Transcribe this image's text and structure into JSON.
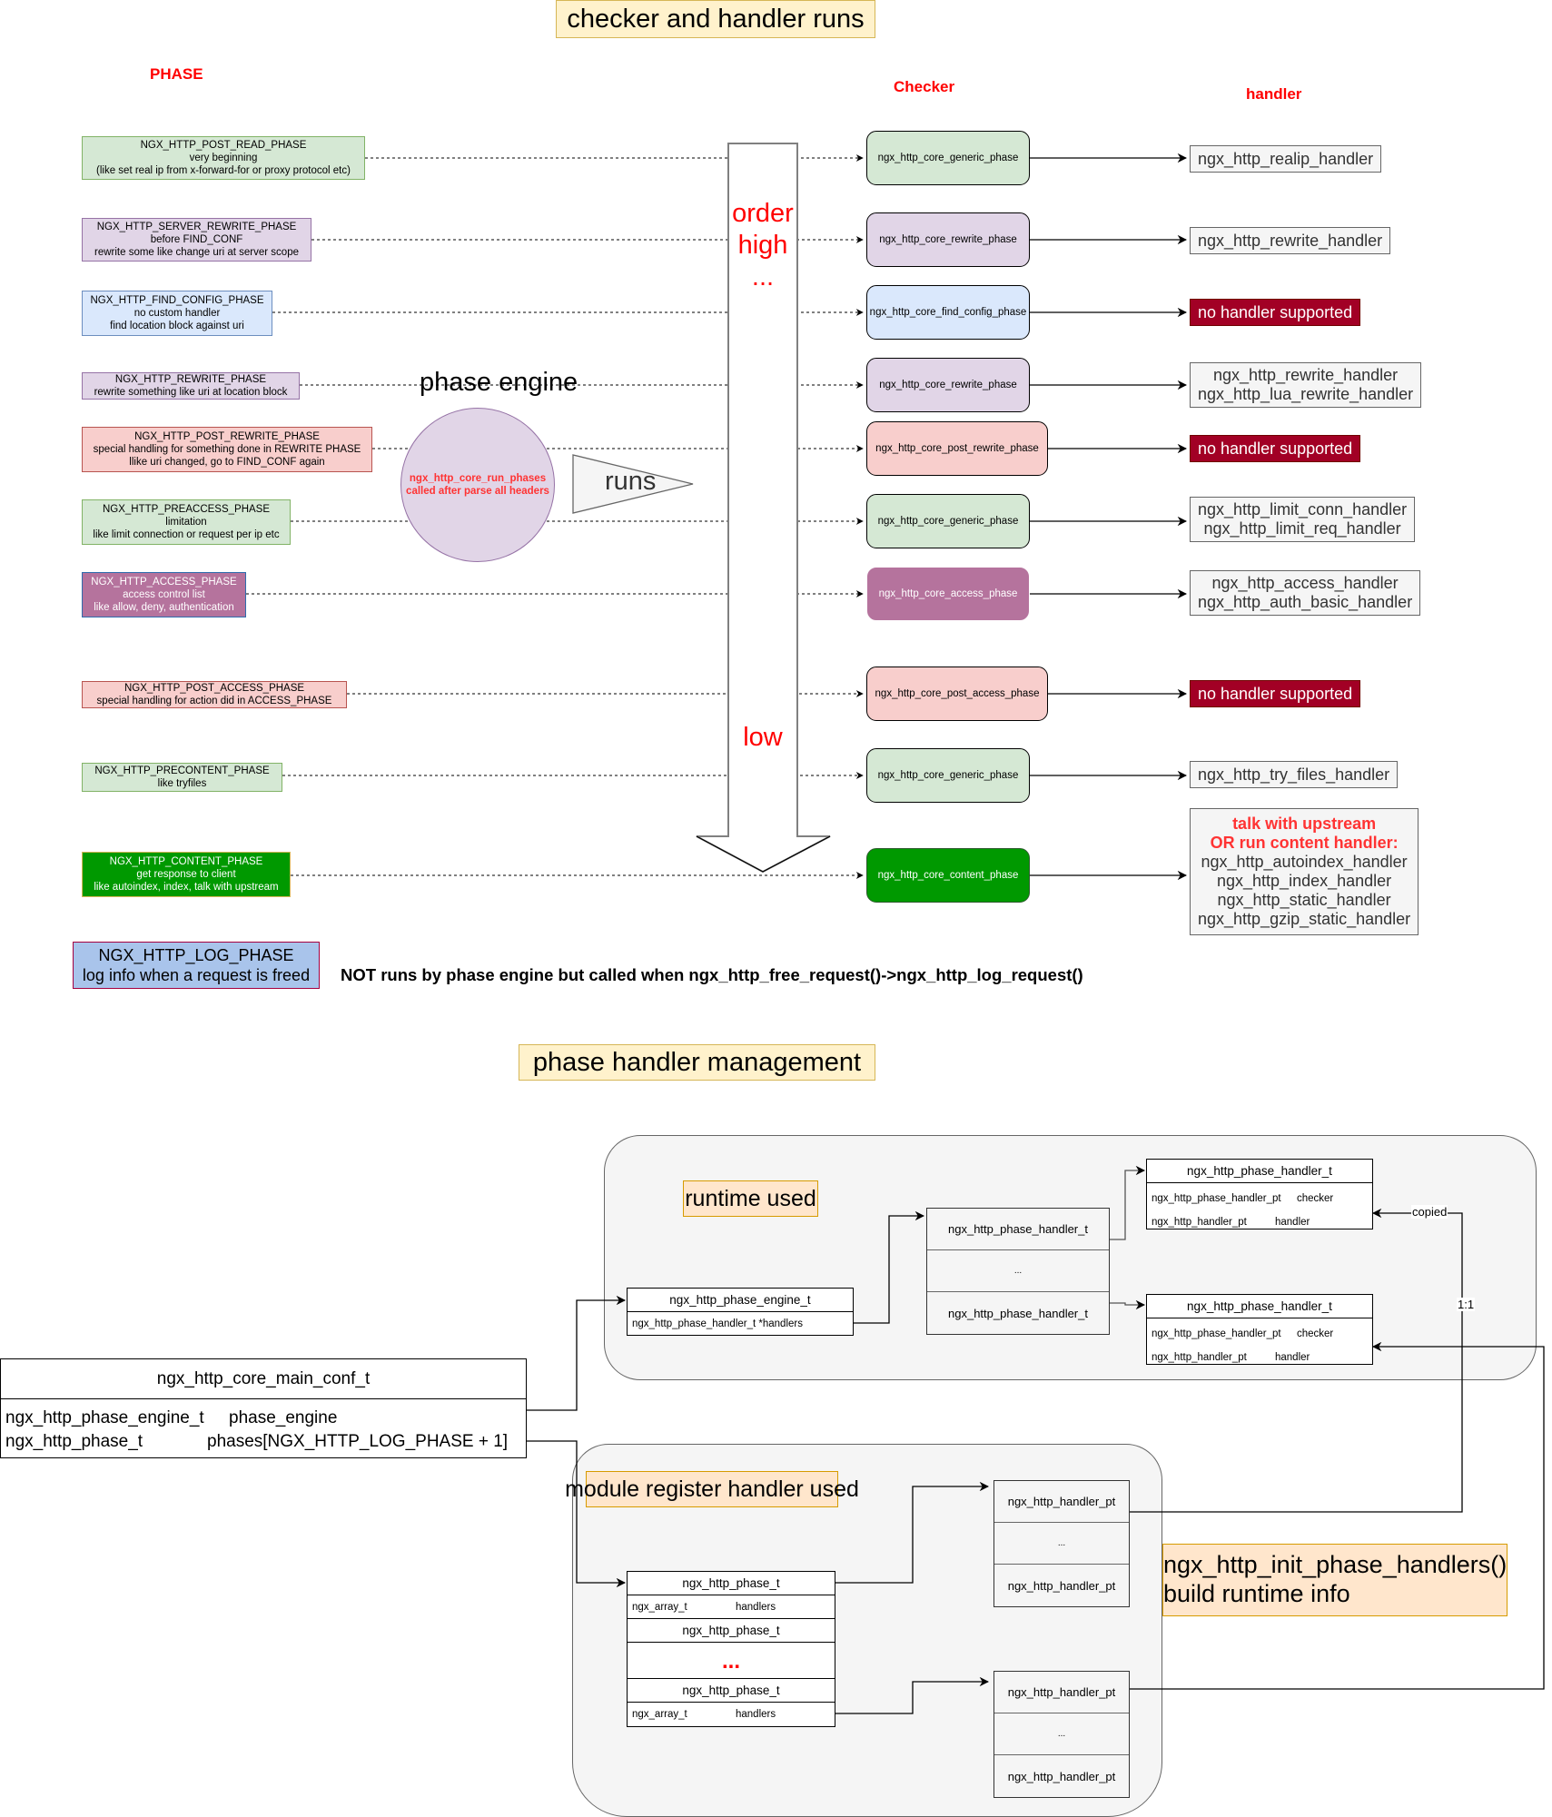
{
  "section1": {
    "title": "checker and handler runs",
    "labels": {
      "phase": "PHASE",
      "checker": "Checker",
      "handler": "handler"
    },
    "order_high": [
      "order",
      "high",
      "..."
    ],
    "order_low": "low",
    "phase_engine": {
      "title": "phase engine",
      "circle_line1": "ngx_http_core_run_phases",
      "circle_line2": "called after parse all headers",
      "runs": "runs"
    },
    "phases": [
      {
        "name": "NGX_HTTP_POST_READ_PHASE",
        "lines": [
          "very beginning",
          "(like set real ip from x-forward-for or proxy protocol etc)"
        ],
        "checker": "ngx_http_core_generic_phase",
        "handlers": [
          "ngx_http_realip_handler"
        ]
      },
      {
        "name": "NGX_HTTP_SERVER_REWRITE_PHASE",
        "lines": [
          "before FIND_CONF",
          "rewrite some like change uri at server scope"
        ],
        "checker": "ngx_http_core_rewrite_phase",
        "handlers": [
          "ngx_http_rewrite_handler"
        ]
      },
      {
        "name": "NGX_HTTP_FIND_CONFIG_PHASE",
        "lines": [
          "no custom handler",
          "find location block against uri"
        ],
        "checker": "ngx_http_core_find_config_phase",
        "handlers": [
          "no handler supported"
        ]
      },
      {
        "name": "NGX_HTTP_REWRITE_PHASE",
        "lines": [
          "rewrite something like uri at location block"
        ],
        "checker": "ngx_http_core_rewrite_phase",
        "handlers": [
          "ngx_http_rewrite_handler",
          "ngx_http_lua_rewrite_handler"
        ]
      },
      {
        "name": "NGX_HTTP_POST_REWRITE_PHASE",
        "lines": [
          "special handling for something done in REWRITE PHASE",
          "llike uri changed, go to FIND_CONF again"
        ],
        "checker": "ngx_http_core_post_rewrite_phase",
        "handlers": [
          "no handler supported"
        ]
      },
      {
        "name": "NGX_HTTP_PREACCESS_PHASE",
        "lines": [
          "limitation",
          "like limit connection or request per ip etc"
        ],
        "checker": "ngx_http_core_generic_phase",
        "handlers": [
          "ngx_http_limit_conn_handler",
          "ngx_http_limit_req_handler"
        ]
      },
      {
        "name": "NGX_HTTP_ACCESS_PHASE",
        "lines": [
          "access control list",
          "like allow, deny, authentication"
        ],
        "checker": "ngx_http_core_access_phase",
        "handlers": [
          "ngx_http_access_handler",
          "ngx_http_auth_basic_handler"
        ]
      },
      {
        "name": "NGX_HTTP_POST_ACCESS_PHASE",
        "lines": [
          "special handling for action did in ACCESS_PHASE"
        ],
        "checker": "ngx_http_core_post_access_phase",
        "handlers": [
          "no handler supported"
        ]
      },
      {
        "name": "NGX_HTTP_PRECONTENT_PHASE",
        "lines": [
          "like tryfiles"
        ],
        "checker": "ngx_http_core_generic_phase",
        "handlers": [
          "ngx_http_try_files_handler"
        ]
      },
      {
        "name": "NGX_HTTP_CONTENT_PHASE",
        "lines": [
          "get response to client",
          "like autoindex, index, talk with upstream"
        ],
        "checker": "ngx_http_core_content_phase",
        "handler_highlight": [
          "talk with upstream",
          "OR run content handler:"
        ],
        "handlers": [
          "ngx_http_autoindex_handler",
          "ngx_http_index_handler",
          "ngx_http_static_handler",
          "ngx_http_gzip_static_handler"
        ]
      }
    ],
    "log_phase": {
      "name": "NGX_HTTP_LOG_PHASE",
      "line": "log info when a request is freed",
      "note": "NOT runs by phase engine but called when ngx_http_free_request()->ngx_http_log_request()"
    }
  },
  "section2": {
    "title": "phase handler management",
    "runtime_label": "runtime used",
    "module_label": "module register handler used",
    "init_label_line1": "ngx_http_init_phase_handlers()",
    "init_label_line2": "build runtime info",
    "main_conf": {
      "title": "ngx_http_core_main_conf_t",
      "fields": [
        {
          "type": "ngx_http_phase_engine_t",
          "name": "phase_engine"
        },
        {
          "type": "ngx_http_phase_t",
          "name": "phases[NGX_HTTP_LOG_PHASE + 1]"
        }
      ]
    },
    "engine": {
      "title": "ngx_http_phase_engine_t",
      "field": "ngx_http_phase_handler_t *handlers"
    },
    "handler_array": [
      "ngx_http_phase_handler_t",
      "...",
      "ngx_http_phase_handler_t"
    ],
    "phase_handler_struct": {
      "title": "ngx_http_phase_handler_t",
      "fields": [
        {
          "type": "ngx_http_phase_handler_pt",
          "name": "checker"
        },
        {
          "type": "ngx_http_handler_pt",
          "name": "handler"
        }
      ]
    },
    "phases_array": {
      "title": "ngx_http_phase_t",
      "field_type": "ngx_array_t",
      "field_name": "handlers",
      "ellipsis": "..."
    },
    "handler_pt_stack": [
      "ngx_http_handler_pt",
      "...",
      "ngx_http_handler_pt"
    ],
    "edge_copied": "copied",
    "edge_ratio": "1:1"
  }
}
